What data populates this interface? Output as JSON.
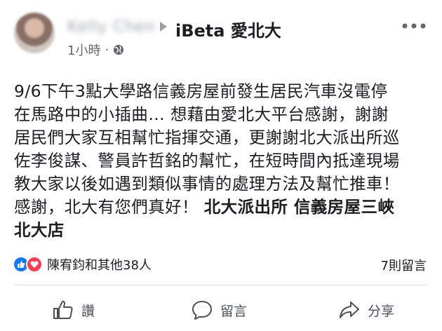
{
  "post": {
    "author_name": "Kelly Chen",
    "group_name": "iBeta 愛北大",
    "time": "1小時",
    "separator": "·",
    "text_lines": [
      "9/6下午3點大學路信義房屋前發生居民汽車沒電停",
      "在馬路中的小插曲… 想藉由愛北大平台感謝，謝謝",
      "居民們大家互相幫忙指揮交通，更謝謝北大派出所巡",
      "佐李俊謀、警員許哲銘的幫忙，在短時間內抵達現場",
      "教大家以後如遇到類似事情的處理方法及幫忙推車！"
    ],
    "text_line6_plain": "感謝，北大有您們真好！ ",
    "text_line6_bold": "北大派出所 信義房屋三峽",
    "text_line7_bold": "北大店"
  },
  "reactions": {
    "summary": "陳宥鈞和其他38人",
    "comments": "7則留言"
  },
  "actions": {
    "like": "讚",
    "comment": "留言",
    "share": "分享"
  },
  "colors": {
    "like_blue": "#1877f2",
    "love_red": "#f33e58",
    "secondary_text": "#65676b"
  },
  "icons": [
    "more-icon",
    "globe-icon",
    "arrow-icon",
    "like-icon",
    "love-icon",
    "thumbs-up-icon",
    "comment-icon",
    "share-icon"
  ]
}
